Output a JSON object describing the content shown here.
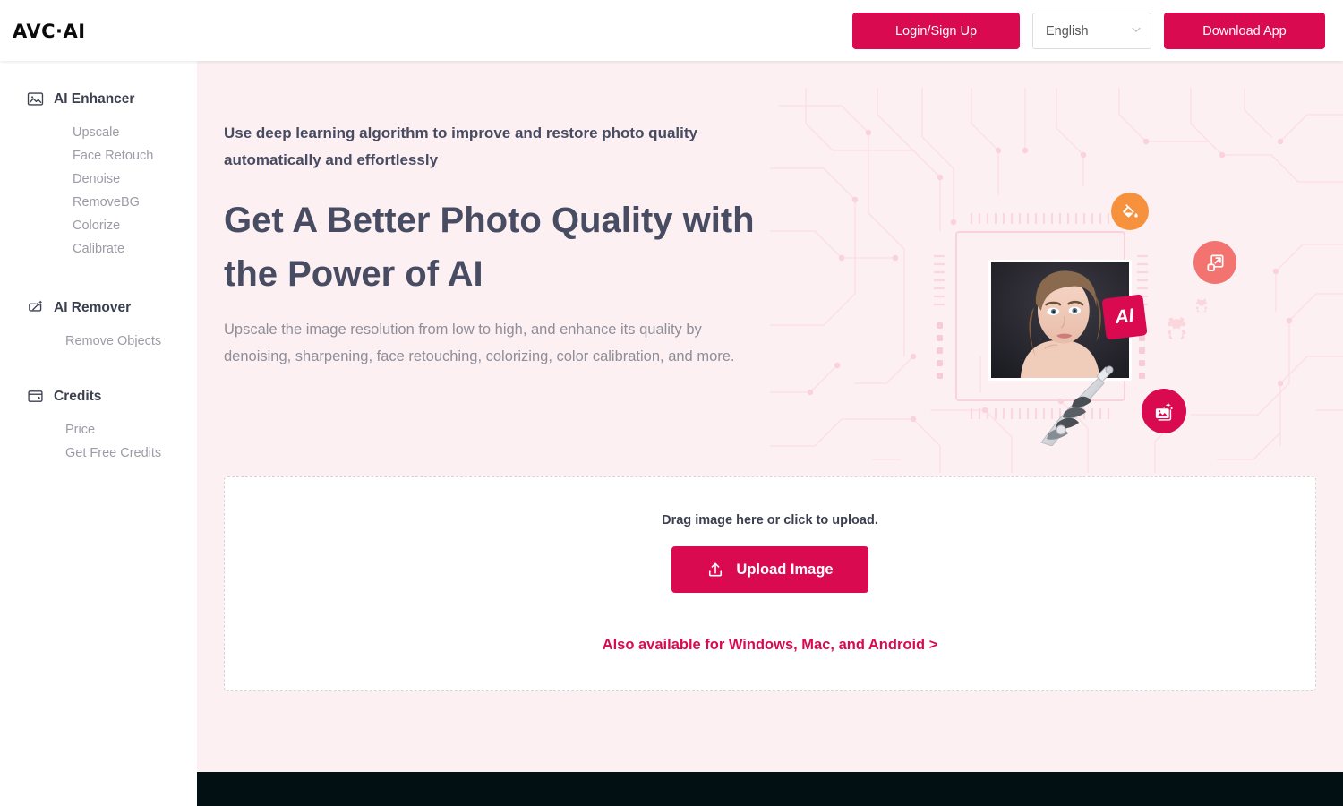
{
  "header": {
    "logo": "AVC·AI",
    "login_label": "Login/Sign Up",
    "language_value": "English",
    "download_label": "Download App",
    "accent_color": "#d90a50"
  },
  "sidebar": {
    "groups": [
      {
        "icon": "image-icon",
        "label": "AI Enhancer",
        "items": [
          "Upscale",
          "Face Retouch",
          "Denoise",
          "RemoveBG",
          "Colorize",
          "Calibrate"
        ]
      },
      {
        "icon": "magic-wand-icon",
        "label": "AI Remover",
        "items": [
          "Remove Objects"
        ]
      },
      {
        "icon": "wallet-icon",
        "label": "Credits",
        "items": [
          "Price",
          "Get Free Credits"
        ]
      }
    ]
  },
  "hero": {
    "subtitle": "Use deep learning algorithm to improve and restore photo quality automatically and effortlessly",
    "title": "Get A Better Photo Quality with the Power of AI",
    "description": "Upscale the image resolution from low to high, and enhance its quality by denoising, sharpening, face retouching, colorizing, color calibration, and more.",
    "illustration": {
      "ai_tile_label": "AI",
      "badges": [
        "paint-bucket-icon",
        "resize-icon",
        "image-sparkle-icon"
      ]
    }
  },
  "uploader": {
    "hint": "Drag image here or click to upload.",
    "button_label": "Upload Image",
    "button_icon": "upload-icon",
    "also_available": "Also available for Windows, Mac, and Android >"
  },
  "colors": {
    "accent": "#d90a50",
    "page_bg": "#fdf0f3",
    "footer": "#021014",
    "heading": "#474c63",
    "muted_text": "#8e8e99",
    "badge_orange": "#f6923e",
    "badge_salmon": "#f2736f"
  }
}
